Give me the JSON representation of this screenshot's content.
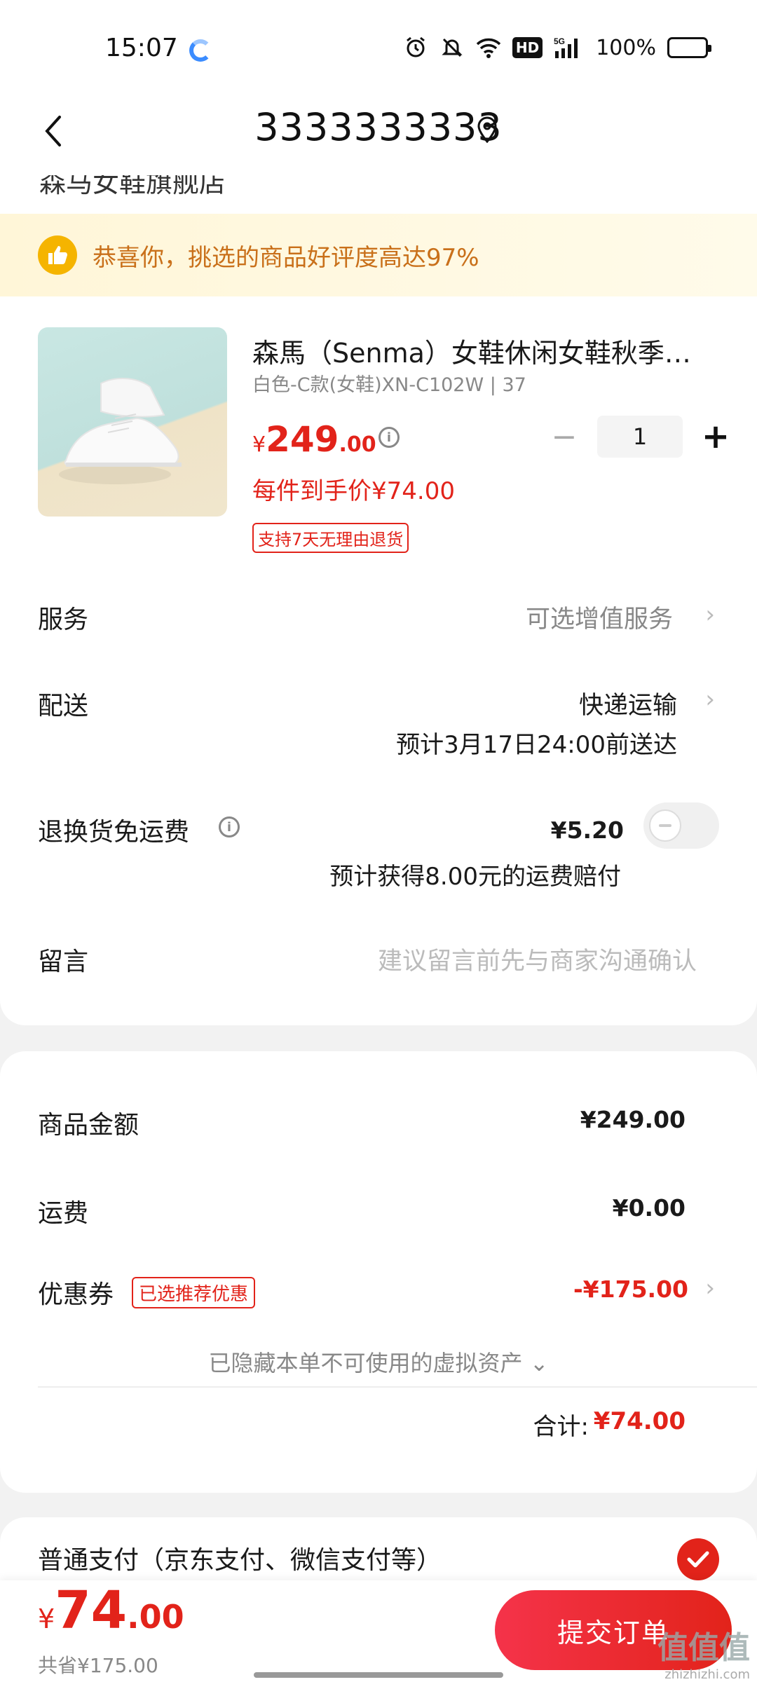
{
  "status_bar": {
    "time": "15:07",
    "network": "5G",
    "hd": "HD",
    "battery": "100%",
    "icons": [
      "alarm-icon",
      "mute-bell-icon",
      "wifi-icon",
      "hd-icon",
      "signal-icon",
      "battery-icon"
    ]
  },
  "header": {
    "title": "3333333333",
    "back_icon": "chevron-left-icon",
    "location_icon": "location-pin-icon"
  },
  "address_strip": {
    "text": "森马女鞋旗舰店"
  },
  "banner": {
    "text": "恭喜你，挑选的商品好评度高达97%",
    "icon": "thumbs-up-icon"
  },
  "product": {
    "title": "森馬（Senma）女鞋休闲女鞋秋季新款小白鞋",
    "spec": "白色-C款(女鞋)XN-C102W | 37",
    "price_currency": "¥",
    "price_integer": "249",
    "price_decimal": ".00",
    "per_item_price": "每件到手价¥74.00",
    "return_tag": "支持7天无理由退货",
    "quantity": "1",
    "qty_minus": "−",
    "qty_plus": "+"
  },
  "rows": {
    "service_label": "服务",
    "service_value": "可选增值服务",
    "delivery_label": "配送",
    "delivery_value": "快递运输",
    "delivery_eta": "预计3月17日24:00前送达",
    "return_shipping_label": "退换货免运费",
    "return_shipping_price": "¥5.20",
    "return_shipping_note": "预计获得8.00元的运费赔付",
    "message_label": "留言",
    "message_placeholder": "建议留言前先与商家沟通确认"
  },
  "summary": {
    "goods_amount_label": "商品金额",
    "goods_amount": "¥249.00",
    "shipping_label": "运费",
    "shipping_amount": "¥0.00",
    "coupon_label": "优惠券",
    "coupon_tag": "已选推荐优惠",
    "coupon_amount": "-¥175.00",
    "hidden_assets": "已隐藏本单不可使用的虚拟资产",
    "total_label": "合计:",
    "total_amount": "¥74.00"
  },
  "payment": {
    "method": "普通支付（京东支付、微信支付等）",
    "selected": true
  },
  "bottom_bar": {
    "currency": "¥",
    "total_integer": "74",
    "total_decimal": ".00",
    "saved": "共省¥175.00",
    "submit_label": "提交订单",
    "watermark": "值值值",
    "watermark_url": "zhizhizhi.com"
  },
  "colors": {
    "accent_red": "#e2231a",
    "banner_text": "#c9701a",
    "banner_bg": "#fff6d8",
    "thumb_icon": "#f5b400"
  }
}
